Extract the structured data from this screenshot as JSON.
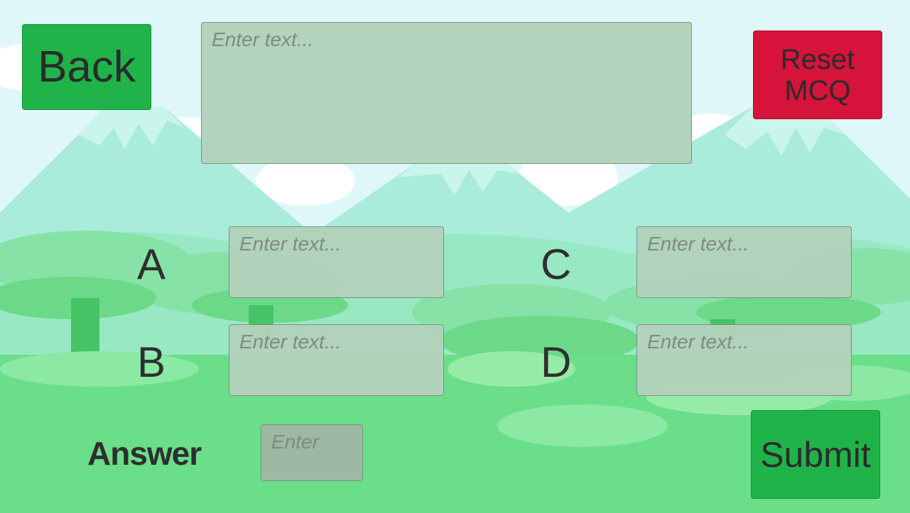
{
  "buttons": {
    "back": "Back",
    "reset_line1": "Reset",
    "reset_line2": "MCQ",
    "submit": "Submit"
  },
  "question": {
    "placeholder": "Enter text..."
  },
  "options": [
    {
      "letter": "A",
      "placeholder": "Enter text..."
    },
    {
      "letter": "B",
      "placeholder": "Enter text..."
    },
    {
      "letter": "C",
      "placeholder": "Enter text..."
    },
    {
      "letter": "D",
      "placeholder": "Enter text..."
    }
  ],
  "answer": {
    "label": "Answer",
    "placeholder": "Enter"
  },
  "colors": {
    "green_button": "#20b34a",
    "red_button": "#d6133a",
    "field_bg": "#b2d2bb"
  }
}
